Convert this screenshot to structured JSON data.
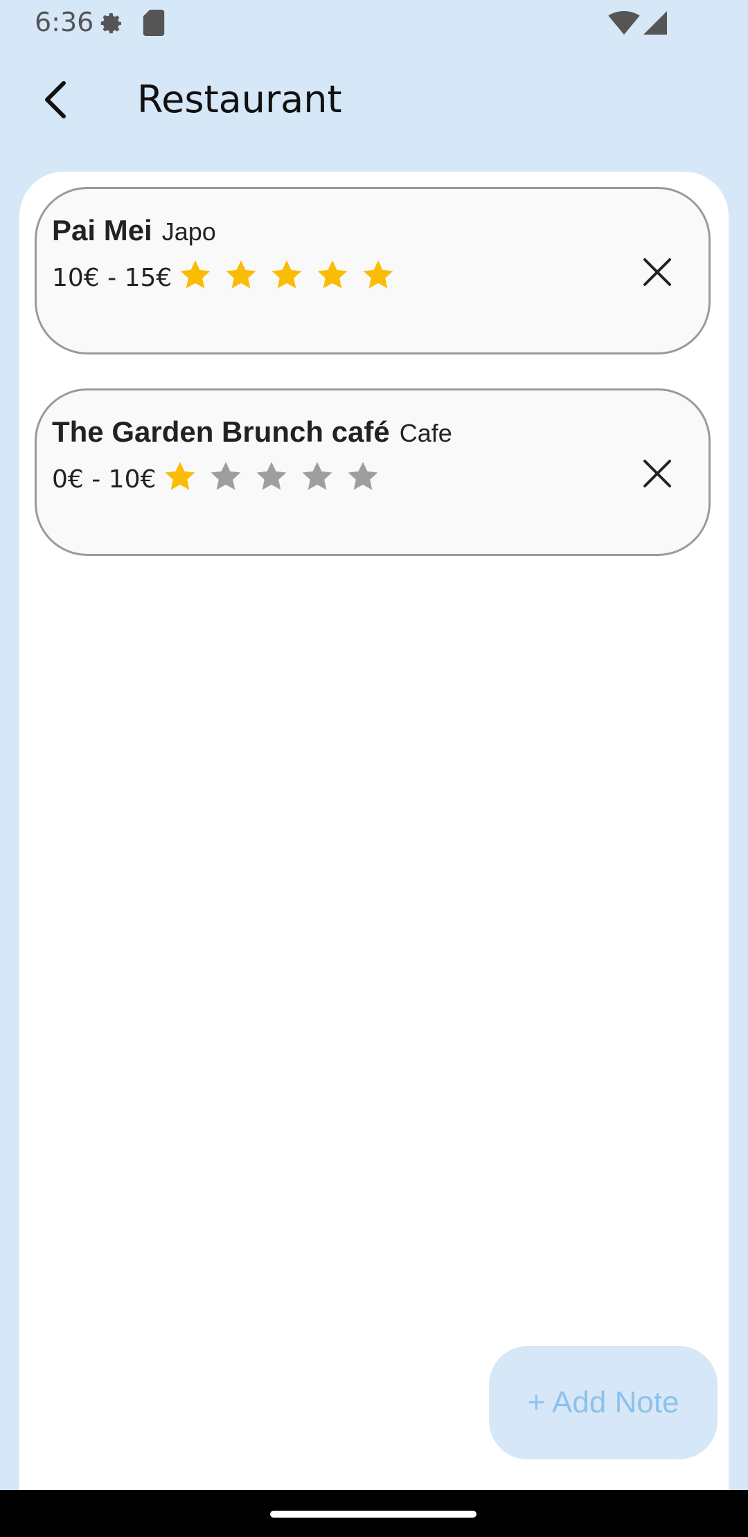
{
  "status_bar": {
    "time": "6:36",
    "icons": [
      "settings-gear-icon",
      "sd-card-icon",
      "wifi-icon",
      "cell-signal-icon"
    ]
  },
  "header": {
    "title": "Restaurant",
    "back_icon": "arrow-back-icon"
  },
  "restaurants": [
    {
      "name": "Pai Mei",
      "type": "Japo",
      "price": "10€ - 15€",
      "rating": 5,
      "max_rating": 5
    },
    {
      "name": "The Garden Brunch café",
      "type": "Cafe",
      "price": "0€ - 10€",
      "rating": 1,
      "max_rating": 5
    }
  ],
  "add_note": {
    "label": "+ Add Note"
  },
  "colors": {
    "background": "#d6e8f7",
    "star_filled": "#fbbc05",
    "star_empty": "#9e9e9e",
    "card_border": "#9a9a9a",
    "accent_text": "#8ec1ea"
  }
}
